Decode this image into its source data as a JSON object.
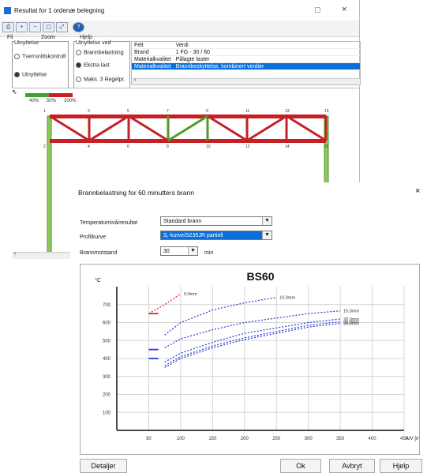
{
  "window": {
    "title": "Resultat for 1 ordenæ belegning",
    "minimize_glyph": "□",
    "close_glyph": "×",
    "menu": [
      "Fil",
      "Zoom",
      "Hjelp"
    ],
    "toolbar_icons": [
      "print-icon",
      "zoom-in-icon",
      "zoom-out-icon",
      "zoom-window-icon",
      "zoom-fit-icon",
      "help-icon"
    ]
  },
  "resultat": {
    "title": "Utnyttelse",
    "options": [
      "Tverrsnittskontroll",
      "Utnyttelse"
    ],
    "selected": 1
  },
  "utnyttelse": {
    "title": "Utnyttelse ved",
    "options": [
      "Brannbelastning",
      "Ekstra last",
      "Maks. 3 Regelpr."
    ],
    "selected": 1
  },
  "props": {
    "headers": [
      "Felt",
      "Verdi"
    ],
    "rows": [
      [
        "Brand",
        "1 FG - 30 / 60"
      ],
      [
        "Materialkvalitet",
        "Pålagte laster"
      ],
      [
        "Materialkvalitet",
        "Brannbeskyttelse, kombinert verdier"
      ]
    ],
    "selected_row": 2
  },
  "legend": {
    "labels": [
      "40%",
      "50%",
      "100%"
    ]
  },
  "truss": {
    "top_nodes": [
      "1",
      "3",
      "5",
      "7",
      "9",
      "11",
      "13",
      "15"
    ],
    "bottom_nodes": [
      "2",
      "4",
      "6",
      "8",
      "10",
      "12",
      "14",
      "16"
    ],
    "colors": {
      "red": "#c62026",
      "green": "#4f9a28",
      "green_fill": "#8fc760"
    }
  },
  "dialog": {
    "title": "Brannbelastning for 60 minutters brann",
    "close_glyph": "×",
    "fields": [
      {
        "label": "Temperaturnivå/resultat",
        "value": "Standard brann",
        "selected": false
      },
      {
        "label": "Profilkurve",
        "value": "S,-kurve/S235JR partiell",
        "selected": true
      },
      {
        "label": "Brannmotstand",
        "value": "30",
        "unit": "min",
        "selected": false
      }
    ],
    "buttons": [
      "Detaljer",
      "Ok",
      "Avbryt",
      "Hjelp"
    ]
  },
  "chart_data": {
    "type": "line",
    "title": "BS60",
    "ylabel": "°C",
    "xlabel": "A/V [m-1]",
    "xlim": [
      0,
      450
    ],
    "ylim": [
      0,
      800
    ],
    "x_ticks": [
      "50",
      "100",
      "150",
      "200",
      "250",
      "300",
      "350",
      "400",
      "450"
    ],
    "y_ticks": [
      "100",
      "200",
      "300",
      "400",
      "500",
      "600",
      "700"
    ],
    "grid": true,
    "series": [
      {
        "name": "0,0mm",
        "color": "#d62b2b",
        "x": [
          50,
          75,
          100
        ],
        "y": [
          650,
          700,
          760
        ]
      },
      {
        "name": "10,0mm",
        "color": "#2a39d8",
        "x": [
          75,
          100,
          150,
          200,
          250
        ],
        "y": [
          530,
          600,
          670,
          710,
          740
        ]
      },
      {
        "name": "15,0mm",
        "color": "#2a39d8",
        "x": [
          75,
          100,
          150,
          200,
          250,
          300,
          350
        ],
        "y": [
          460,
          510,
          560,
          600,
          625,
          650,
          665
        ]
      },
      {
        "name": "20,0mm",
        "color": "#2a39d8",
        "x": [
          75,
          100,
          150,
          200,
          250,
          300,
          350
        ],
        "y": [
          380,
          430,
          490,
          540,
          570,
          600,
          620
        ]
      },
      {
        "name": "25,0mm",
        "color": "#2a39d8",
        "x": [
          75,
          100,
          150,
          200,
          250,
          300,
          350
        ],
        "y": [
          360,
          410,
          470,
          515,
          550,
          585,
          605
        ]
      },
      {
        "name": "30,0mm",
        "color": "#2a39d8",
        "x": [
          75,
          100,
          150,
          200,
          250,
          300,
          350
        ],
        "y": [
          350,
          400,
          460,
          505,
          540,
          575,
          595
        ]
      }
    ],
    "solid_segments": [
      {
        "color": "#d62b2b",
        "y": 650
      },
      {
        "color": "#2a39d8",
        "y": 450
      },
      {
        "color": "#2a39d8",
        "y": 400
      }
    ]
  }
}
